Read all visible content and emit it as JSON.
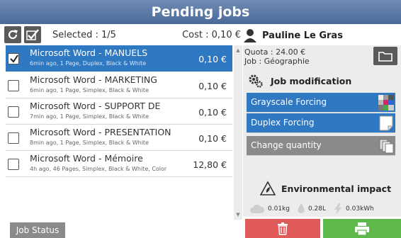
{
  "title": "Pending jobs",
  "toolbar": {
    "selected": "Selected : 1/5",
    "cost": "Cost : 0,10 €",
    "icons": [
      "refresh-icon",
      "select-all-icon"
    ]
  },
  "user": {
    "name": "Pauline Le Gras",
    "quota": "Quota : 24.00 €",
    "job": "Job : Géographie"
  },
  "jobs": [
    {
      "name": "Microsoft Word - MANUELS",
      "detail": "6min ago, 1 Page, Duplex, Black & White",
      "price": "0,10 €",
      "selected": true
    },
    {
      "name": "Microsoft Word - MARKETING",
      "detail": "6min ago, 1 Page, Simplex, Black & White",
      "price": "0,10 €",
      "selected": false
    },
    {
      "name": "Microsoft Word - SUPPORT DE",
      "detail": "7min ago, 1 Page, Simplex, Black & White",
      "price": "0,10 €",
      "selected": false
    },
    {
      "name": "Microsoft Word - PRESENTATION",
      "detail": "8min ago, 1 Page, Simplex, Black & White",
      "price": "0,10 €",
      "selected": false
    },
    {
      "name": "Microsoft Word - Mémoire",
      "detail": "4h ago, 46 Pages, Simplex, Black & White, Color",
      "price": "12,80 €",
      "selected": false
    }
  ],
  "job_modification": {
    "title": "Job modification",
    "options": [
      {
        "label": "Grayscale Forcing",
        "active": true,
        "icon": "grayscale-icon"
      },
      {
        "label": "Duplex Forcing",
        "active": true,
        "icon": "duplex-icon"
      },
      {
        "label": "Change quantity",
        "active": false,
        "icon": "copies-icon"
      }
    ]
  },
  "environment": {
    "title": "Environmental impact",
    "co2": "0.01kg",
    "water": "0.28L",
    "energy": "0.03kWh"
  },
  "footer": {
    "job_status": "Job Status"
  },
  "colors": {
    "title_bar": "#4a6a98",
    "selected_row": "#2f78c2",
    "delete": "#e05a5a",
    "print": "#5fb94a"
  }
}
